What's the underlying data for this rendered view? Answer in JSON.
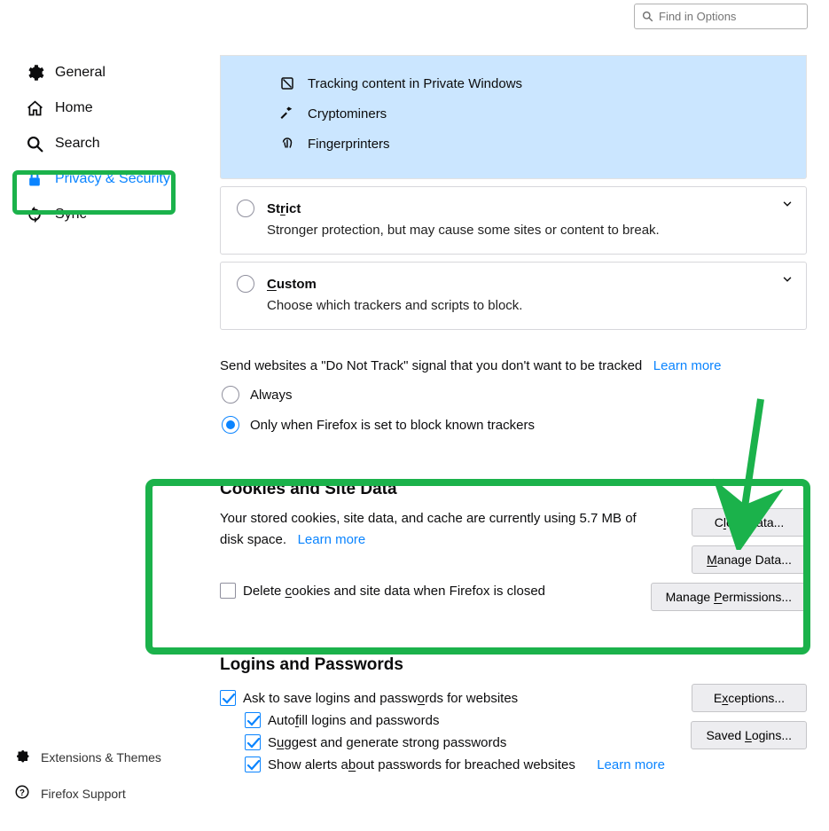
{
  "search": {
    "placeholder": "Find in Options"
  },
  "sidebar": {
    "general": "General",
    "home": "Home",
    "search": "Search",
    "privacy": "Privacy & Security",
    "sync": "Sync"
  },
  "footer": {
    "extensions": "Extensions & Themes",
    "support": "Firefox Support"
  },
  "tracking_features": {
    "tracking_content": "Tracking content in Private Windows",
    "cryptominers": "Cryptominers",
    "fingerprinters": "Fingerprinters"
  },
  "strict": {
    "title": "Strict",
    "desc": "Stronger protection, but may cause some sites or content to break."
  },
  "custom": {
    "title": "Custom",
    "desc": "Choose which trackers and scripts to block."
  },
  "dnt": {
    "text": "Send websites a \"Do Not Track\" signal that you don't want to be tracked",
    "learn": "Learn more",
    "always": "Always",
    "only_when": "Only when Firefox is set to block known trackers"
  },
  "cookies": {
    "heading": "Cookies and Site Data",
    "desc_prefix": "Your stored cookies, site data, and cache are currently using ",
    "size": "5.7 MB",
    "desc_suffix": " of disk space.",
    "learn": "Learn more",
    "delete_close": "Delete cookies and site data when Firefox is closed",
    "clear": "Clear Data...",
    "manage_data": "Manage Data...",
    "manage_perm": "Manage Permissions..."
  },
  "logins": {
    "heading": "Logins and Passwords",
    "ask_save": "Ask to save logins and passwords for websites",
    "autofill": "Autofill logins and passwords",
    "suggest": "Suggest and generate strong passwords",
    "breached": "Show alerts about passwords for breached websites",
    "learn": "Learn more",
    "exceptions": "Exceptions...",
    "saved": "Saved Logins..."
  }
}
